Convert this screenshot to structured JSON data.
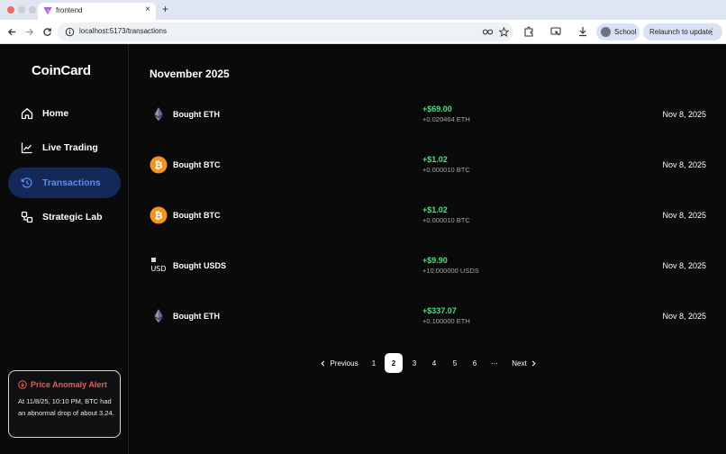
{
  "browser": {
    "tab_title": "frontend",
    "tab_close": "×",
    "new_tab": "+",
    "url": "localhost:5173/transactions",
    "profile_label": "School",
    "relaunch_label": "Relaunch to update",
    "relaunch_menu": "⋮"
  },
  "app": {
    "logo": "CoinCard",
    "nav": [
      {
        "label": "Home",
        "icon": "home-icon"
      },
      {
        "label": "Live Trading",
        "icon": "chart-line-icon"
      },
      {
        "label": "Transactions",
        "icon": "history-icon",
        "active": true
      },
      {
        "label": "Strategic Lab",
        "icon": "shapes-icon"
      }
    ],
    "alert": {
      "title": "Price Anomaly Alert",
      "body": "At 11/8/25, 10:10 PM, BTC had an abnormal drop of about 3.24."
    }
  },
  "main": {
    "month": "November 2025",
    "transactions": [
      {
        "title": "Bought ETH",
        "usd": "+$69.00",
        "coin_amount": "+0.020464 ETH",
        "date": "Nov 8, 2025",
        "icon": "eth-icon"
      },
      {
        "title": "Bought BTC",
        "usd": "+$1.02",
        "coin_amount": "+0.000010 BTC",
        "date": "Nov 8, 2025",
        "icon": "btc-icon"
      },
      {
        "title": "Bought BTC",
        "usd": "+$1.02",
        "coin_amount": "+0.000010 BTC",
        "date": "Nov 8, 2025",
        "icon": "btc-icon"
      },
      {
        "title": "Bought USDS",
        "usd": "+$9.90",
        "coin_amount": "+10.000000 USDS",
        "date": "Nov 8, 2025",
        "icon": "usds-icon"
      },
      {
        "title": "Bought ETH",
        "usd": "+$337.07",
        "coin_amount": "+0.100000 ETH",
        "date": "Nov 8, 2025",
        "icon": "eth-icon"
      }
    ],
    "usds_icon_text": "USD",
    "pagination": {
      "previous": "Previous",
      "pages": [
        "1",
        "2",
        "3",
        "4",
        "5",
        "6"
      ],
      "current": "2",
      "ellipsis": "⋯",
      "next": "Next"
    }
  },
  "colors": {
    "accent_blue": "#5b8cf5",
    "active_bg": "#14295a",
    "positive_green": "#4ade80",
    "alert_red": "#f05a4a",
    "btc_orange": "#f7931a"
  }
}
